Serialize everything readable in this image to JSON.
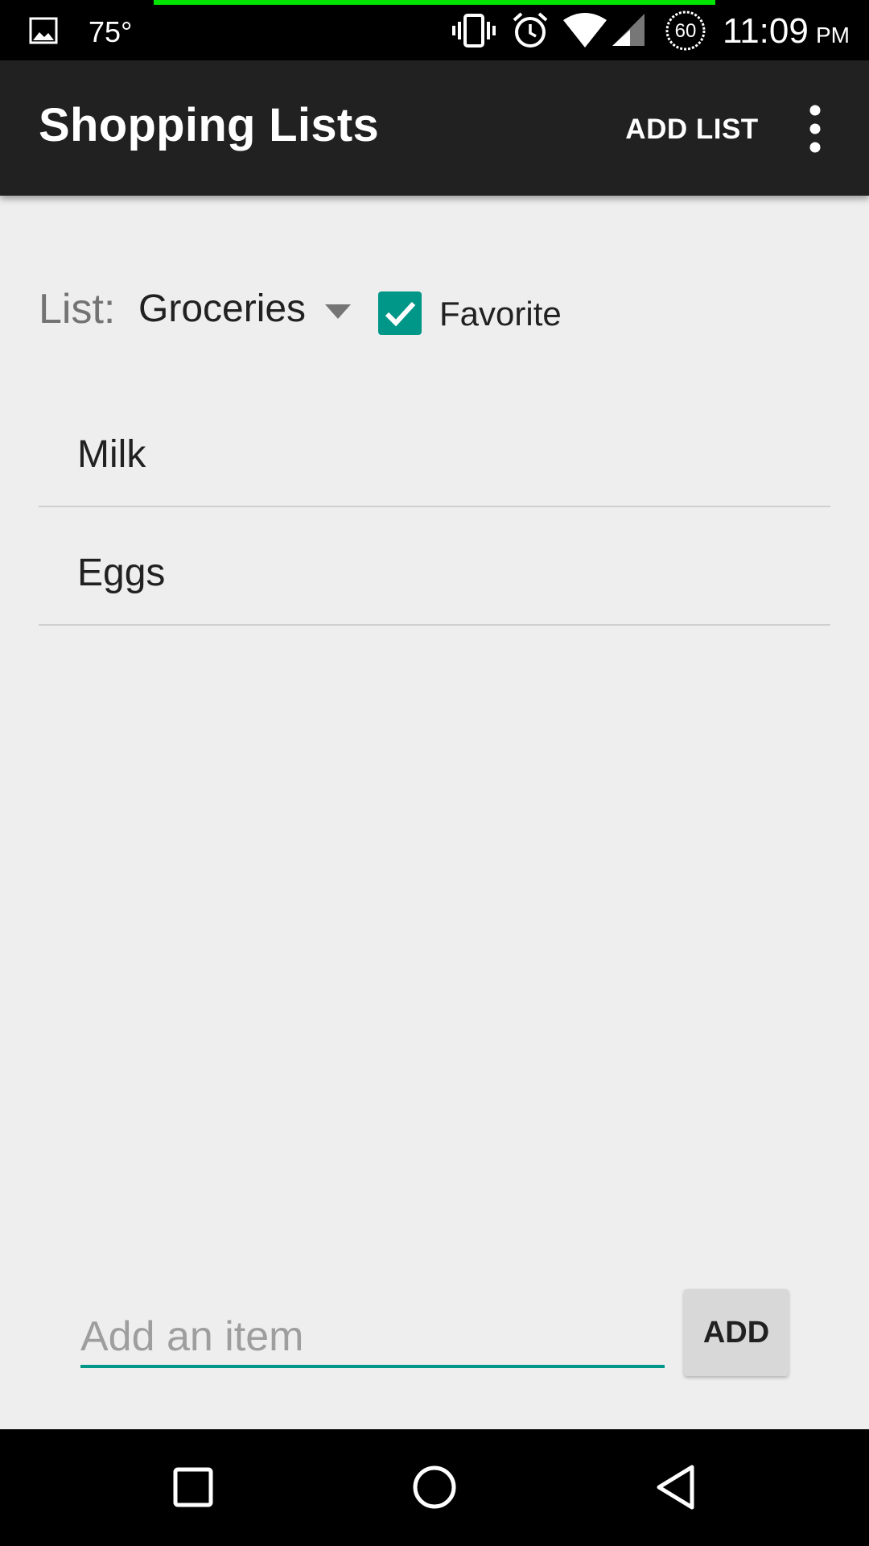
{
  "status_bar": {
    "temperature": "75°",
    "battery_level": "60",
    "time": "11:09",
    "ampm": "PM",
    "icons": [
      "image-icon",
      "vibrate-icon",
      "alarm-icon",
      "wifi-icon",
      "cell-signal-icon",
      "battery-icon"
    ],
    "progress_color": "#00e400"
  },
  "app_bar": {
    "title": "Shopping Lists",
    "add_list_label": "ADD LIST",
    "overflow_icon": "more-vert-icon"
  },
  "list_selector": {
    "label": "List:",
    "selected": "Groceries",
    "favorite_label": "Favorite",
    "favorite_checked": true
  },
  "items": [
    {
      "label": "Milk"
    },
    {
      "label": "Eggs"
    }
  ],
  "add_item": {
    "placeholder": "Add an item",
    "value": "",
    "button_label": "ADD"
  },
  "colors": {
    "accent": "#009688",
    "app_bar": "#212121",
    "background": "#eeeeee"
  },
  "nav_bar": {
    "icons": [
      "recents-icon",
      "home-icon",
      "back-icon"
    ]
  }
}
